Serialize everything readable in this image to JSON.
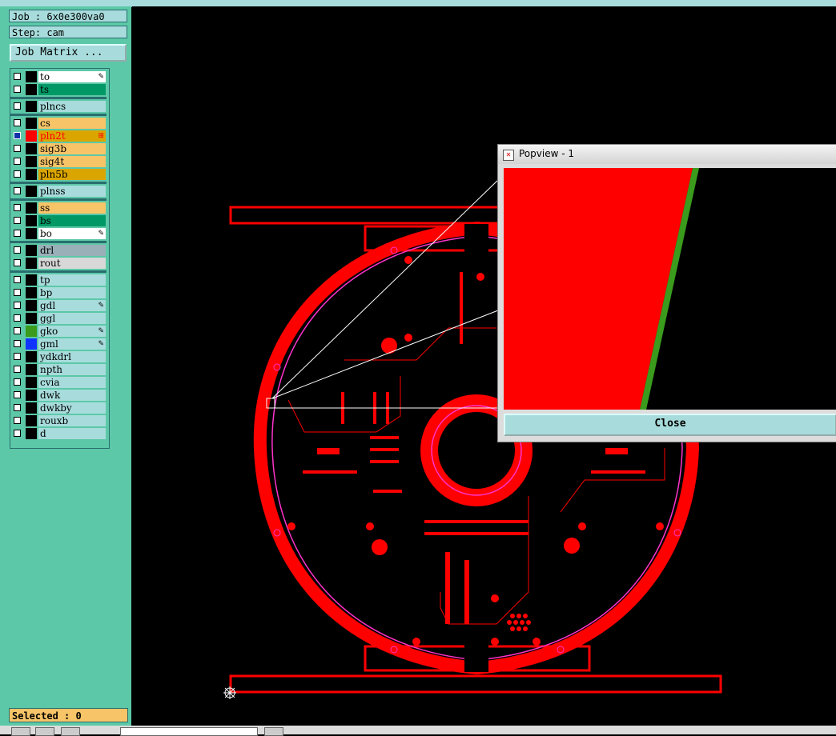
{
  "panel": {
    "job_label": "Job : 6x0e300va0",
    "step_label": "Step: cam",
    "job_matrix_button": "Job Matrix ...",
    "selected_label": "Selected : 0"
  },
  "layers": [
    {
      "name": "to",
      "color": "#ffffff",
      "mark": "✎"
    },
    {
      "name": "ts",
      "color": "#009966",
      "mark": ""
    },
    {
      "name": "plncs",
      "color": "#a8dcdc",
      "mark": ""
    },
    {
      "name": "cs",
      "color": "#f7c468",
      "mark": ""
    },
    {
      "name": "pln2t",
      "color": "#dba500",
      "mark": "⊞",
      "active": true
    },
    {
      "name": "sig3b",
      "color": "#f7c468",
      "mark": ""
    },
    {
      "name": "sig4t",
      "color": "#f7c468",
      "mark": ""
    },
    {
      "name": "pln5b",
      "color": "#dba500",
      "mark": ""
    },
    {
      "name": "plnss",
      "color": "#a8dcdc",
      "mark": ""
    },
    {
      "name": "ss",
      "color": "#f7c468",
      "mark": ""
    },
    {
      "name": "bs",
      "color": "#009966",
      "mark": ""
    },
    {
      "name": "bo",
      "color": "#ffffff",
      "mark": "✎"
    },
    {
      "name": "drl",
      "color": "#9ab0b8",
      "mark": ""
    },
    {
      "name": "rout",
      "color": "#d8d8d8",
      "mark": ""
    },
    {
      "name": "tp",
      "color": "#a8dcdc",
      "mark": ""
    },
    {
      "name": "bp",
      "color": "#a8dcdc",
      "mark": ""
    },
    {
      "name": "gdl",
      "color": "#a8dcdc",
      "mark": "✎"
    },
    {
      "name": "ggl",
      "color": "#a8dcdc",
      "mark": ""
    },
    {
      "name": "gko",
      "color": "#a8dcdc",
      "mark": "✎"
    },
    {
      "name": "gml",
      "color": "#a8dcdc",
      "mark": "✎"
    },
    {
      "name": "ydkdrl",
      "color": "#a8dcdc",
      "mark": ""
    },
    {
      "name": "npth",
      "color": "#a8dcdc",
      "mark": ""
    },
    {
      "name": "cvia",
      "color": "#a8dcdc",
      "mark": ""
    },
    {
      "name": "dwk",
      "color": "#a8dcdc",
      "mark": ""
    },
    {
      "name": "dwkby",
      "color": "#a8dcdc",
      "mark": ""
    },
    {
      "name": "rouxb",
      "color": "#a8dcdc",
      "mark": ""
    },
    {
      "name": "d",
      "color": "#a8dcdc",
      "mark": ""
    }
  ],
  "popview": {
    "title": "Popview - 1",
    "close_label": "Close"
  },
  "colors": {
    "copper": "#ff0000",
    "outline": "#ff33cc",
    "panel_bg": "#5cc8a8",
    "cell_bg": "#a8dcdc",
    "selected_bg": "#f7c468"
  }
}
